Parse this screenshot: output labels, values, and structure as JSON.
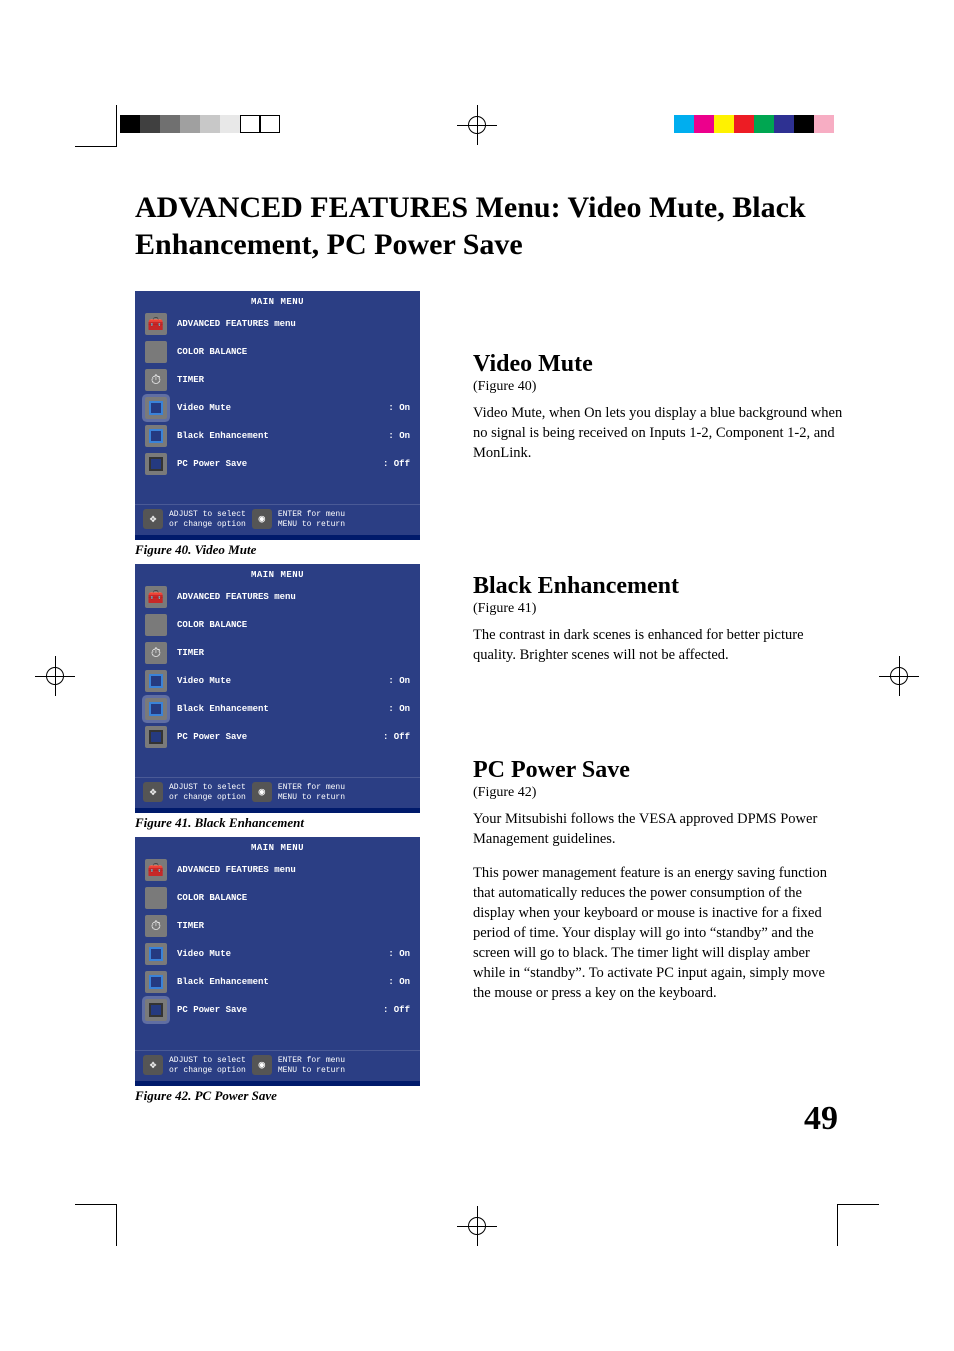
{
  "page_title": "ADVANCED FEATURES Menu:  Video Mute, Black Enhancement, PC Power Save",
  "page_number": "49",
  "colorbar_left": [
    "#000000",
    "#404040",
    "#707070",
    "#a0a0a0",
    "#c8c8c8",
    "#e8e8e8",
    "#ffffff",
    "#ffffff"
  ],
  "colorbar_right": [
    "#00aeef",
    "#ec008c",
    "#fff200",
    "#ed1c24",
    "#00a651",
    "#2e3192",
    "#000000",
    "#f7adc3"
  ],
  "menu": {
    "title": "MAIN MENU",
    "items": [
      {
        "label": "ADVANCED FEATURES menu",
        "val": "",
        "icon": "toolbox"
      },
      {
        "label": "COLOR BALANCE",
        "val": "",
        "icon": "cb"
      },
      {
        "label": "TIMER",
        "val": "",
        "icon": "timer"
      },
      {
        "label": "Video Mute",
        "val": ": On",
        "icon": "sq-on"
      },
      {
        "label": "Black Enhancement",
        "val": ": On",
        "icon": "sq-on"
      },
      {
        "label": "PC Power Save",
        "val": ": Off",
        "icon": "sq-off"
      }
    ],
    "footer": {
      "l1": "ADJUST to select",
      "l2": "or change option",
      "r1": "ENTER for menu",
      "r2": "MENU to return"
    }
  },
  "figures": [
    {
      "caption": "Figure 40.  Video Mute",
      "highlight": 3
    },
    {
      "caption": "Figure 41.  Black Enhancement",
      "highlight": 4
    },
    {
      "caption": "Figure 42.  PC Power Save",
      "highlight": 5
    }
  ],
  "sections": {
    "video_mute": {
      "heading": "Video Mute",
      "sub": "(Figure 40)",
      "body": "Video Mute, when On lets you display a blue background when no signal is being received on Inputs 1-2,  Component 1-2, and MonLink."
    },
    "black_enh": {
      "heading": "Black Enhancement",
      "sub": "(Figure 41)",
      "body": "The contrast in dark scenes is enhanced for better picture quality.  Brighter scenes will not be affected."
    },
    "pc_power": {
      "heading": "PC Power Save",
      "sub": "(Figure 42)",
      "body1": "Your Mitsubishi follows the VESA approved DPMS Power Management guidelines.",
      "body2": "This power management feature is an energy saving function that automatically reduces the power consumption of the display when your keyboard or mouse is inactive for a fixed period of time.  Your display will go into “standby” and the screen will go to black.  The timer light will display amber while in “standby”.  To activate PC input again, simply move the mouse or press a key on the keyboard."
    }
  }
}
